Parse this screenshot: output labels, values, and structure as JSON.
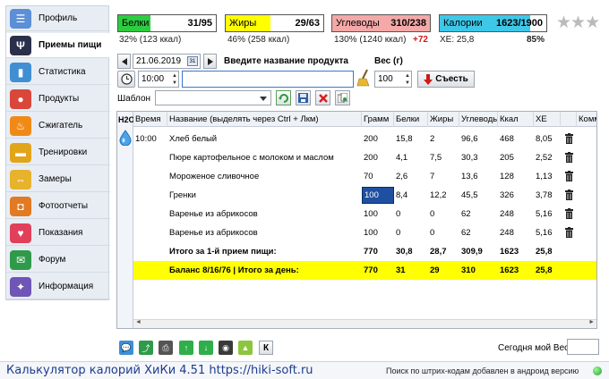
{
  "sidebar": {
    "items": [
      {
        "label": "Профиль",
        "icon": "profile-card-icon",
        "color": "#5b8fd6"
      },
      {
        "label": "Приемы пищи",
        "icon": "fork-knife-icon",
        "color": "#2a2f4a"
      },
      {
        "label": "Статистика",
        "icon": "stats-chart-icon",
        "color": "#3f8fd2"
      },
      {
        "label": "Продукты",
        "icon": "food-products-icon",
        "color": "#d9473a"
      },
      {
        "label": "Сжигатель",
        "icon": "flame-icon",
        "color": "#f08a17"
      },
      {
        "label": "Тренировки",
        "icon": "dumbbell-icon",
        "color": "#e2a51a"
      },
      {
        "label": "Замеры",
        "icon": "tape-measure-icon",
        "color": "#e7b22c"
      },
      {
        "label": "Фотоотчеты",
        "icon": "camera-icon",
        "color": "#e17a22"
      },
      {
        "label": "Показания",
        "icon": "heart-pulse-icon",
        "color": "#e0405a"
      },
      {
        "label": "Форум",
        "icon": "forum-chat-icon",
        "color": "#2f9b4a"
      },
      {
        "label": "Информация",
        "icon": "info-bulb-icon",
        "color": "#6f55b5"
      }
    ]
  },
  "macros": {
    "protein": {
      "label": "Белки",
      "value": "31/95",
      "sub": "32% (123 ккал)",
      "color": "#2ecc40",
      "fill": 0.33
    },
    "fat": {
      "label": "Жиры",
      "value": "29/63",
      "sub": "46% (258 ккал)",
      "color": "#ffff00",
      "fill": 0.46
    },
    "carbs": {
      "label": "Углеводы",
      "value": "310/238",
      "sub": "130% (1240 ккал)",
      "extra": "+72",
      "color": "#f4a8a8",
      "fill": 1.0
    },
    "calories": {
      "label": "Калории",
      "value": "1623/1900",
      "sub": "ХЕ: 25,8",
      "percent": "85%",
      "color": "#3ec8e8",
      "fill": 0.85
    }
  },
  "controls": {
    "date": "21.06.2019",
    "time": "10:00",
    "product_prompt": "Введите название продукта",
    "product_value": "",
    "weight_label": "Вес (г)",
    "weight_value": "100",
    "eat_button": "Съесть",
    "template_label": "Шаблон",
    "template_value": ""
  },
  "table": {
    "h2o": "H2O",
    "headers": [
      "Время",
      "Название (выделять через Ctrl + Лкм)",
      "Грамм",
      "Белки",
      "Жиры",
      "Углеводы",
      "Ккал",
      "ХЕ",
      "",
      "Коммента"
    ],
    "rows": [
      {
        "time": "10:00",
        "name": "Хлеб белый",
        "gram": "200",
        "protein": "15,8",
        "fat": "2",
        "carbs": "96,6",
        "kcal": "468",
        "xe": "8,05"
      },
      {
        "time": "",
        "name": "Пюре картофельное с молоком и маслом",
        "gram": "200",
        "protein": "4,1",
        "fat": "7,5",
        "carbs": "30,3",
        "kcal": "205",
        "xe": "2,52"
      },
      {
        "time": "",
        "name": "Мороженое сливочное",
        "gram": "70",
        "protein": "2,6",
        "fat": "7",
        "carbs": "13,6",
        "kcal": "128",
        "xe": "1,13"
      },
      {
        "time": "",
        "name": "Гренки",
        "gram": "100",
        "protein": "8,4",
        "fat": "12,2",
        "carbs": "45,5",
        "kcal": "326",
        "xe": "3,78"
      },
      {
        "time": "",
        "name": "Варенье из абрикосов",
        "gram": "100",
        "protein": "0",
        "fat": "0",
        "carbs": "62",
        "kcal": "248",
        "xe": "5,16"
      },
      {
        "time": "",
        "name": "Варенье из абрикосов",
        "gram": "100",
        "protein": "0",
        "fat": "0",
        "carbs": "62",
        "kcal": "248",
        "xe": "5,16"
      }
    ],
    "total": {
      "name": "Итого за 1-й прием пищи:",
      "gram": "770",
      "protein": "30,8",
      "fat": "28,7",
      "carbs": "309,9",
      "kcal": "1623",
      "xe": "25,8"
    },
    "balance": {
      "name": "Баланс 8/16/76  |  Итого за день:",
      "gram": "770",
      "protein": "31",
      "fat": "29",
      "carbs": "310",
      "kcal": "1623",
      "xe": "25,8"
    }
  },
  "bottom": {
    "weight_today_label": "Сегодня мой Вес",
    "weight_today_value": "",
    "k_label": "К"
  },
  "status": {
    "app_title": "Калькулятор калорий ХиКи 4.51 https://hiki-soft.ru",
    "message": "Поиск по штрих-кодам добавлен в андроид версию"
  }
}
